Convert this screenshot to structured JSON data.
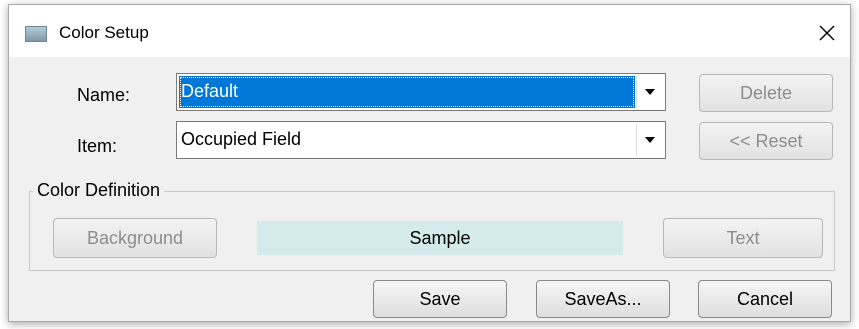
{
  "window": {
    "title": "Color Setup",
    "close_glyph": "✕",
    "icon": "app-window-icon"
  },
  "form": {
    "name_label": "Name:",
    "name_value": "Default",
    "item_label": "Item:",
    "item_value": "Occupied Field",
    "dropdown_glyph": "▼"
  },
  "side_buttons": {
    "delete": "Delete",
    "reset": "<< Reset"
  },
  "color_definition": {
    "group_title": "Color Definition",
    "background_button": "Background",
    "sample_text": "Sample",
    "text_button": "Text",
    "sample_color": "#d5ebeb"
  },
  "footer": {
    "save": "Save",
    "save_as": "SaveAs...",
    "cancel": "Cancel"
  },
  "colors": {
    "selection": "#0078d7",
    "dialog_background": "#f0f0f0",
    "disabled_text": "#8d8d8d"
  }
}
